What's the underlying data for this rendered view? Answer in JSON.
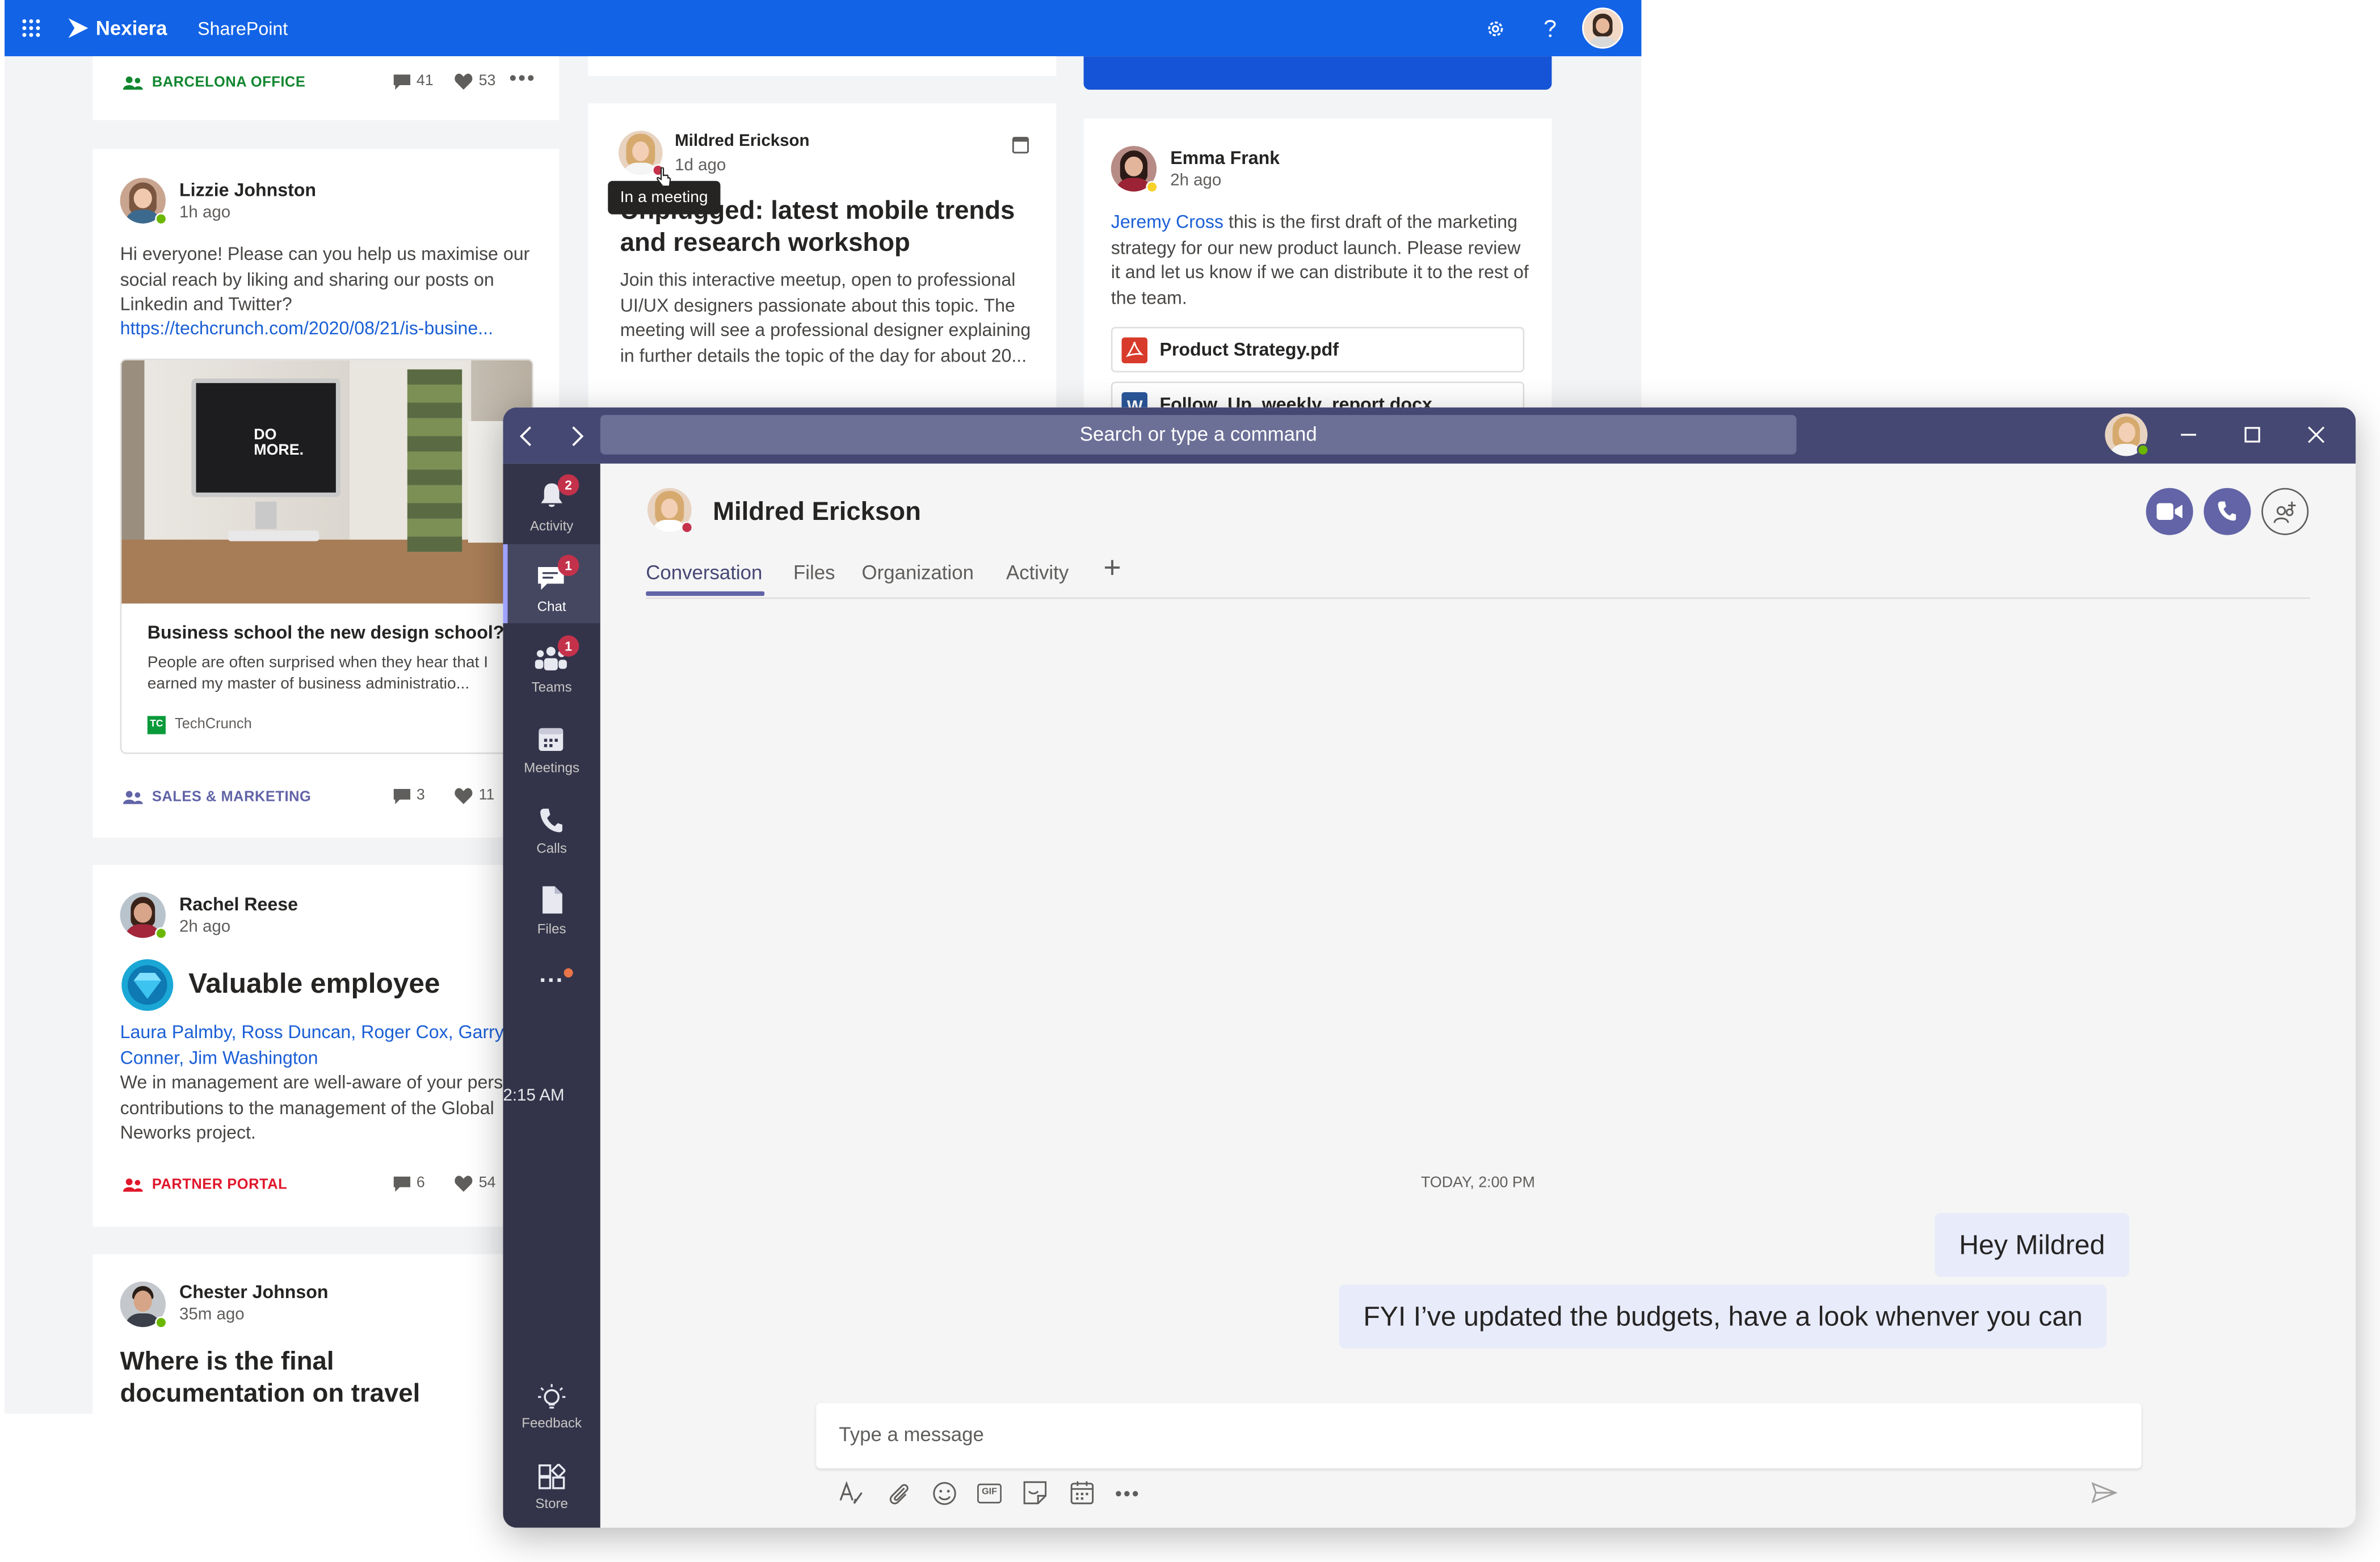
{
  "sharepoint": {
    "brand": "Nexiera",
    "app": "SharePoint",
    "colors": {
      "bar": "#1263e6",
      "tag_green": "#11862f",
      "tag_purple": "#6264a7",
      "tag_red": "#e0172b"
    },
    "card_top": {
      "tag": "BARCELONA OFFICE",
      "comments": "41",
      "likes": "53"
    },
    "lizzie": {
      "name": "Lizzie Johnston",
      "time": "1h ago",
      "text": "Hi everyone! Please can you help us maximise our social reach by liking and sharing our posts on Linkedin and Twitter?",
      "link": "https://techcrunch.com/2020/08/21/is-busine...",
      "preview_title": "Business school the new design school?",
      "preview_text": "People are often surprised when they hear that I earned my master of business administratio...",
      "preview_source": "TechCrunch",
      "preview_source_icon": "TC",
      "monitor_text": "DO MORE.",
      "tag": "SALES & MARKETING",
      "comments": "3",
      "likes": "11"
    },
    "mildred_post": {
      "name": "Mildred Erickson",
      "time": "1d ago",
      "tooltip": "In a meeting",
      "title": "Unplugged: latest mobile trends and research workshop",
      "text": "Join this interactive meetup, open to professional UI/UX designers passionate about this topic. The meeting will see a professional designer explaining in further details the topic of the day for about 20..."
    },
    "emma": {
      "name": "Emma Frank",
      "time": "2h ago",
      "mention": "Jeremy Cross",
      "text": " this is the first draft of the marketing strategy for our new product launch. Please review it and let us know if we can distribute it to the rest of the team.",
      "file1": "Product Strategy.pdf",
      "file2": "Follow_Up_weekly_report.docx"
    },
    "rachel": {
      "name": "Rachel Reese",
      "time": "2h ago",
      "award": "Valuable employee",
      "people": "Laura Palmby, Ross Duncan, Roger Cox, Garry Conner, Jim Washington",
      "text": "We in management are well-aware of your personal contributions to the management of the Global Neworks project.",
      "tag": "PARTNER PORTAL",
      "comments": "6",
      "likes": "54"
    },
    "chester": {
      "name": "Chester Johnson",
      "time": "35m ago",
      "title": "Where is the final documentation on travel"
    }
  },
  "teams": {
    "colors": {
      "titlebar": "#454872",
      "rail": "#33344a",
      "accent": "#6264a7"
    },
    "search_placeholder": "Search or type a command",
    "rail": [
      {
        "label": "Activity",
        "badge": "2",
        "icon": "bell-icon"
      },
      {
        "label": "Chat",
        "badge": "1",
        "icon": "chat-icon"
      },
      {
        "label": "Teams",
        "badge": "1",
        "icon": "teams-icon"
      },
      {
        "label": "Meetings",
        "badge": "",
        "icon": "calendar-icon"
      },
      {
        "label": "Calls",
        "badge": "",
        "icon": "phone-icon"
      },
      {
        "label": "Files",
        "badge": "",
        "icon": "file-icon"
      }
    ],
    "rail_more": "...",
    "rail_bottom": [
      {
        "label": "Feedback",
        "icon": "lightbulb-icon"
      },
      {
        "label": "Store",
        "icon": "store-icon"
      }
    ],
    "chat": {
      "name": "Mildred Erickson",
      "tabs": [
        "Conversation",
        "Files",
        "Organization",
        "Activity"
      ],
      "add_tab": "+",
      "faded_time": "2:15 AM",
      "date_label": "TODAY, 2:00 PM",
      "messages": [
        "Hey Mildred",
        "FYI I’ve updated the budgets, have a look whenver you can"
      ],
      "compose_placeholder": "Type a message",
      "gif_label": "GIF"
    }
  }
}
